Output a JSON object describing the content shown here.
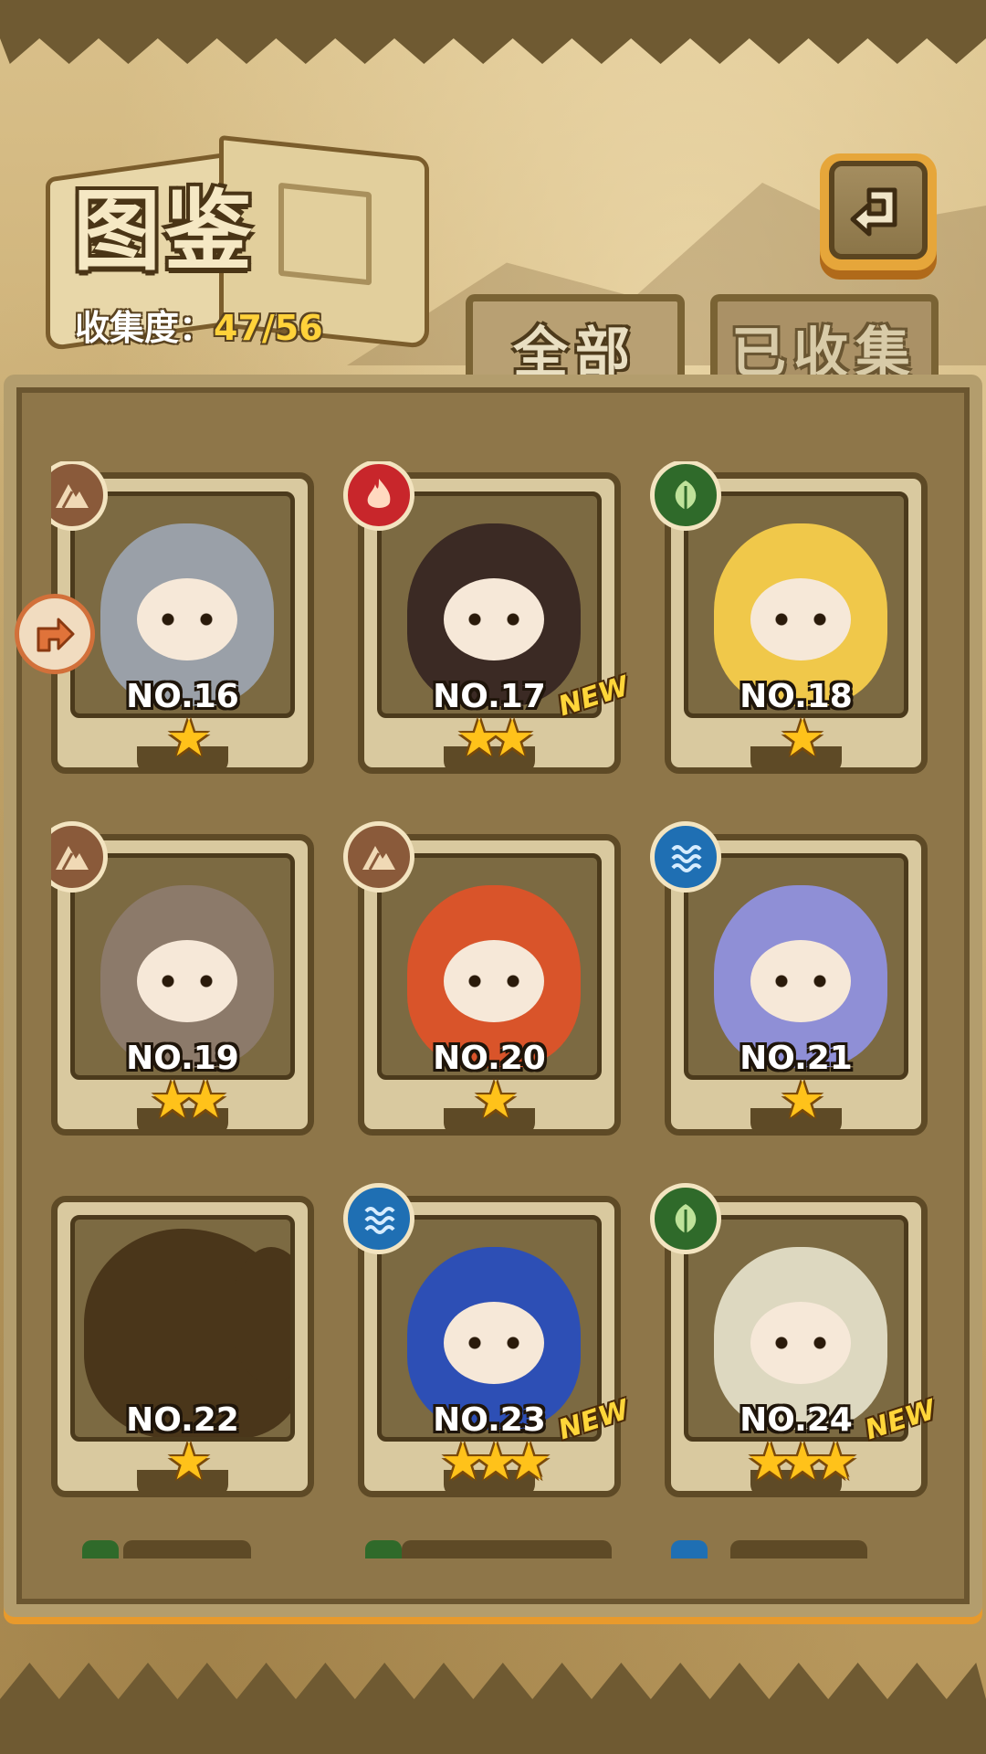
{
  "header": {
    "title": "图鉴",
    "collection_label": "收集度：",
    "collection_value": "47/56"
  },
  "tabs": [
    {
      "label": "全部",
      "active": true
    },
    {
      "label": "已收集",
      "active": false
    }
  ],
  "cards": [
    {
      "number": "NO.16",
      "stars": "★",
      "element": "earth",
      "is_new": false,
      "locked": false,
      "color": "#9aa0a8"
    },
    {
      "number": "NO.17",
      "stars": "★★",
      "element": "fire",
      "is_new": true,
      "locked": false,
      "color": "#3b2a24"
    },
    {
      "number": "NO.18",
      "stars": "★",
      "element": "leaf",
      "is_new": false,
      "locked": false,
      "color": "#f0c84a"
    },
    {
      "number": "NO.19",
      "stars": "★★",
      "element": "earth",
      "is_new": false,
      "locked": false,
      "color": "#8c7a6a"
    },
    {
      "number": "NO.20",
      "stars": "★",
      "element": "earth",
      "is_new": false,
      "locked": false,
      "color": "#d9542a"
    },
    {
      "number": "NO.21",
      "stars": "★",
      "element": "water",
      "is_new": false,
      "locked": false,
      "color": "#8f8fd6"
    },
    {
      "number": "NO.22",
      "stars": "★",
      "element": "",
      "is_new": false,
      "locked": true,
      "color": "#4a361a"
    },
    {
      "number": "NO.23",
      "stars": "★★★",
      "element": "water",
      "is_new": true,
      "locked": false,
      "color": "#2d4fb5"
    },
    {
      "number": "NO.24",
      "stars": "★★★",
      "element": "leaf",
      "is_new": true,
      "locked": false,
      "color": "#ddd8c0"
    }
  ],
  "new_badge": "NEW",
  "icons": {
    "back": "return-arrow-icon",
    "side": "turn-arrow-icon",
    "earth": "mountain-element-icon",
    "fire": "flame-element-icon",
    "leaf": "leaf-element-icon",
    "water": "wave-element-icon"
  },
  "colors": {
    "accent": "#e89a2c",
    "star": "#ffc21a",
    "collection_value": "#ffd23a"
  }
}
